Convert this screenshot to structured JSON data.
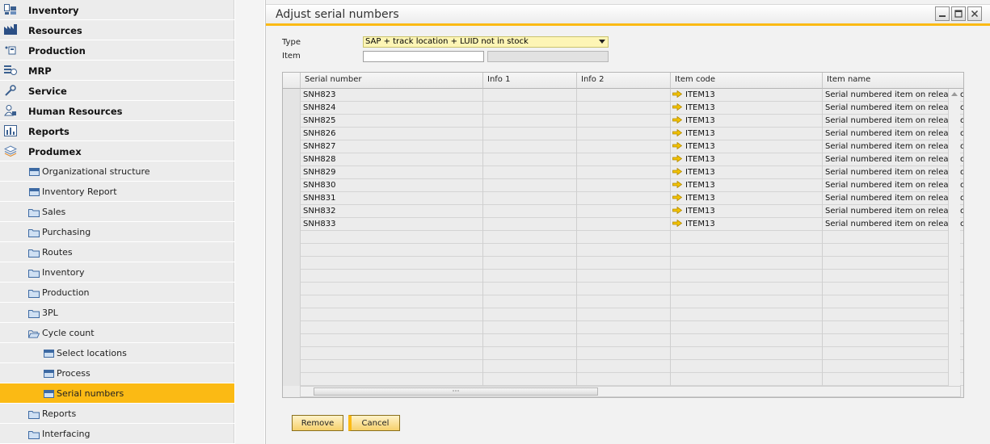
{
  "sidebar": {
    "items": [
      {
        "label": "Inventory",
        "icon": "inventory-icon",
        "level": 0
      },
      {
        "label": "Resources",
        "icon": "resources-icon",
        "level": 0
      },
      {
        "label": "Production",
        "icon": "production-icon",
        "level": 0
      },
      {
        "label": "MRP",
        "icon": "mrp-icon",
        "level": 0
      },
      {
        "label": "Service",
        "icon": "service-icon",
        "level": 0
      },
      {
        "label": "Human Resources",
        "icon": "human-resources-icon",
        "level": 0
      },
      {
        "label": "Reports",
        "icon": "reports-icon",
        "level": 0
      },
      {
        "label": "Produmex",
        "icon": "produmex-icon",
        "level": 0
      },
      {
        "label": "Organizational structure",
        "icon": "window-icon",
        "level": 1
      },
      {
        "label": "Inventory Report",
        "icon": "window-icon",
        "level": 1
      },
      {
        "label": "Sales",
        "icon": "folder-icon",
        "level": 1
      },
      {
        "label": "Purchasing",
        "icon": "folder-icon",
        "level": 1
      },
      {
        "label": "Routes",
        "icon": "folder-icon",
        "level": 1
      },
      {
        "label": "Inventory",
        "icon": "folder-icon",
        "level": 1
      },
      {
        "label": "Production",
        "icon": "folder-icon",
        "level": 1
      },
      {
        "label": "3PL",
        "icon": "folder-icon",
        "level": 1
      },
      {
        "label": "Cycle count",
        "icon": "folder-open-icon",
        "level": 1
      },
      {
        "label": "Select locations",
        "icon": "window-icon",
        "level": 2
      },
      {
        "label": "Process",
        "icon": "window-icon",
        "level": 2
      },
      {
        "label": "Serial numbers",
        "icon": "window-icon",
        "level": 2,
        "active": true
      },
      {
        "label": "Reports",
        "icon": "folder-icon",
        "level": 1
      },
      {
        "label": "Interfacing",
        "icon": "folder-icon",
        "level": 1
      }
    ]
  },
  "window": {
    "title": "Adjust serial numbers",
    "controls": [
      "minimize-icon",
      "maximize-icon",
      "close-icon"
    ]
  },
  "form": {
    "type_label": "Type",
    "type_value": "SAP + track location + LUID not in stock",
    "item_label": "Item",
    "item_value": "",
    "item_description": ""
  },
  "grid": {
    "columns": [
      "Serial number",
      "Info 1",
      "Info 2",
      "Item code",
      "Item name"
    ],
    "rows": [
      {
        "serial": "SNH823",
        "info1": "",
        "info2": "",
        "item_code": "ITEM13",
        "item_name": "Serial numbered item on release only"
      },
      {
        "serial": "SNH824",
        "info1": "",
        "info2": "",
        "item_code": "ITEM13",
        "item_name": "Serial numbered item on release only"
      },
      {
        "serial": "SNH825",
        "info1": "",
        "info2": "",
        "item_code": "ITEM13",
        "item_name": "Serial numbered item on release only"
      },
      {
        "serial": "SNH826",
        "info1": "",
        "info2": "",
        "item_code": "ITEM13",
        "item_name": "Serial numbered item on release only"
      },
      {
        "serial": "SNH827",
        "info1": "",
        "info2": "",
        "item_code": "ITEM13",
        "item_name": "Serial numbered item on release only"
      },
      {
        "serial": "SNH828",
        "info1": "",
        "info2": "",
        "item_code": "ITEM13",
        "item_name": "Serial numbered item on release only"
      },
      {
        "serial": "SNH829",
        "info1": "",
        "info2": "",
        "item_code": "ITEM13",
        "item_name": "Serial numbered item on release only"
      },
      {
        "serial": "SNH830",
        "info1": "",
        "info2": "",
        "item_code": "ITEM13",
        "item_name": "Serial numbered item on release only"
      },
      {
        "serial": "SNH831",
        "info1": "",
        "info2": "",
        "item_code": "ITEM13",
        "item_name": "Serial numbered item on release only"
      },
      {
        "serial": "SNH832",
        "info1": "",
        "info2": "",
        "item_code": "ITEM13",
        "item_name": "Serial numbered item on release only"
      },
      {
        "serial": "SNH833",
        "info1": "",
        "info2": "",
        "item_code": "ITEM13",
        "item_name": "Serial numbered item on release only"
      }
    ]
  },
  "buttons": {
    "remove": "Remove",
    "cancel": "Cancel"
  },
  "colors": {
    "accent": "#fbba14",
    "select_bg": "#fdf5b5",
    "link_arrow": "#f2c200"
  }
}
